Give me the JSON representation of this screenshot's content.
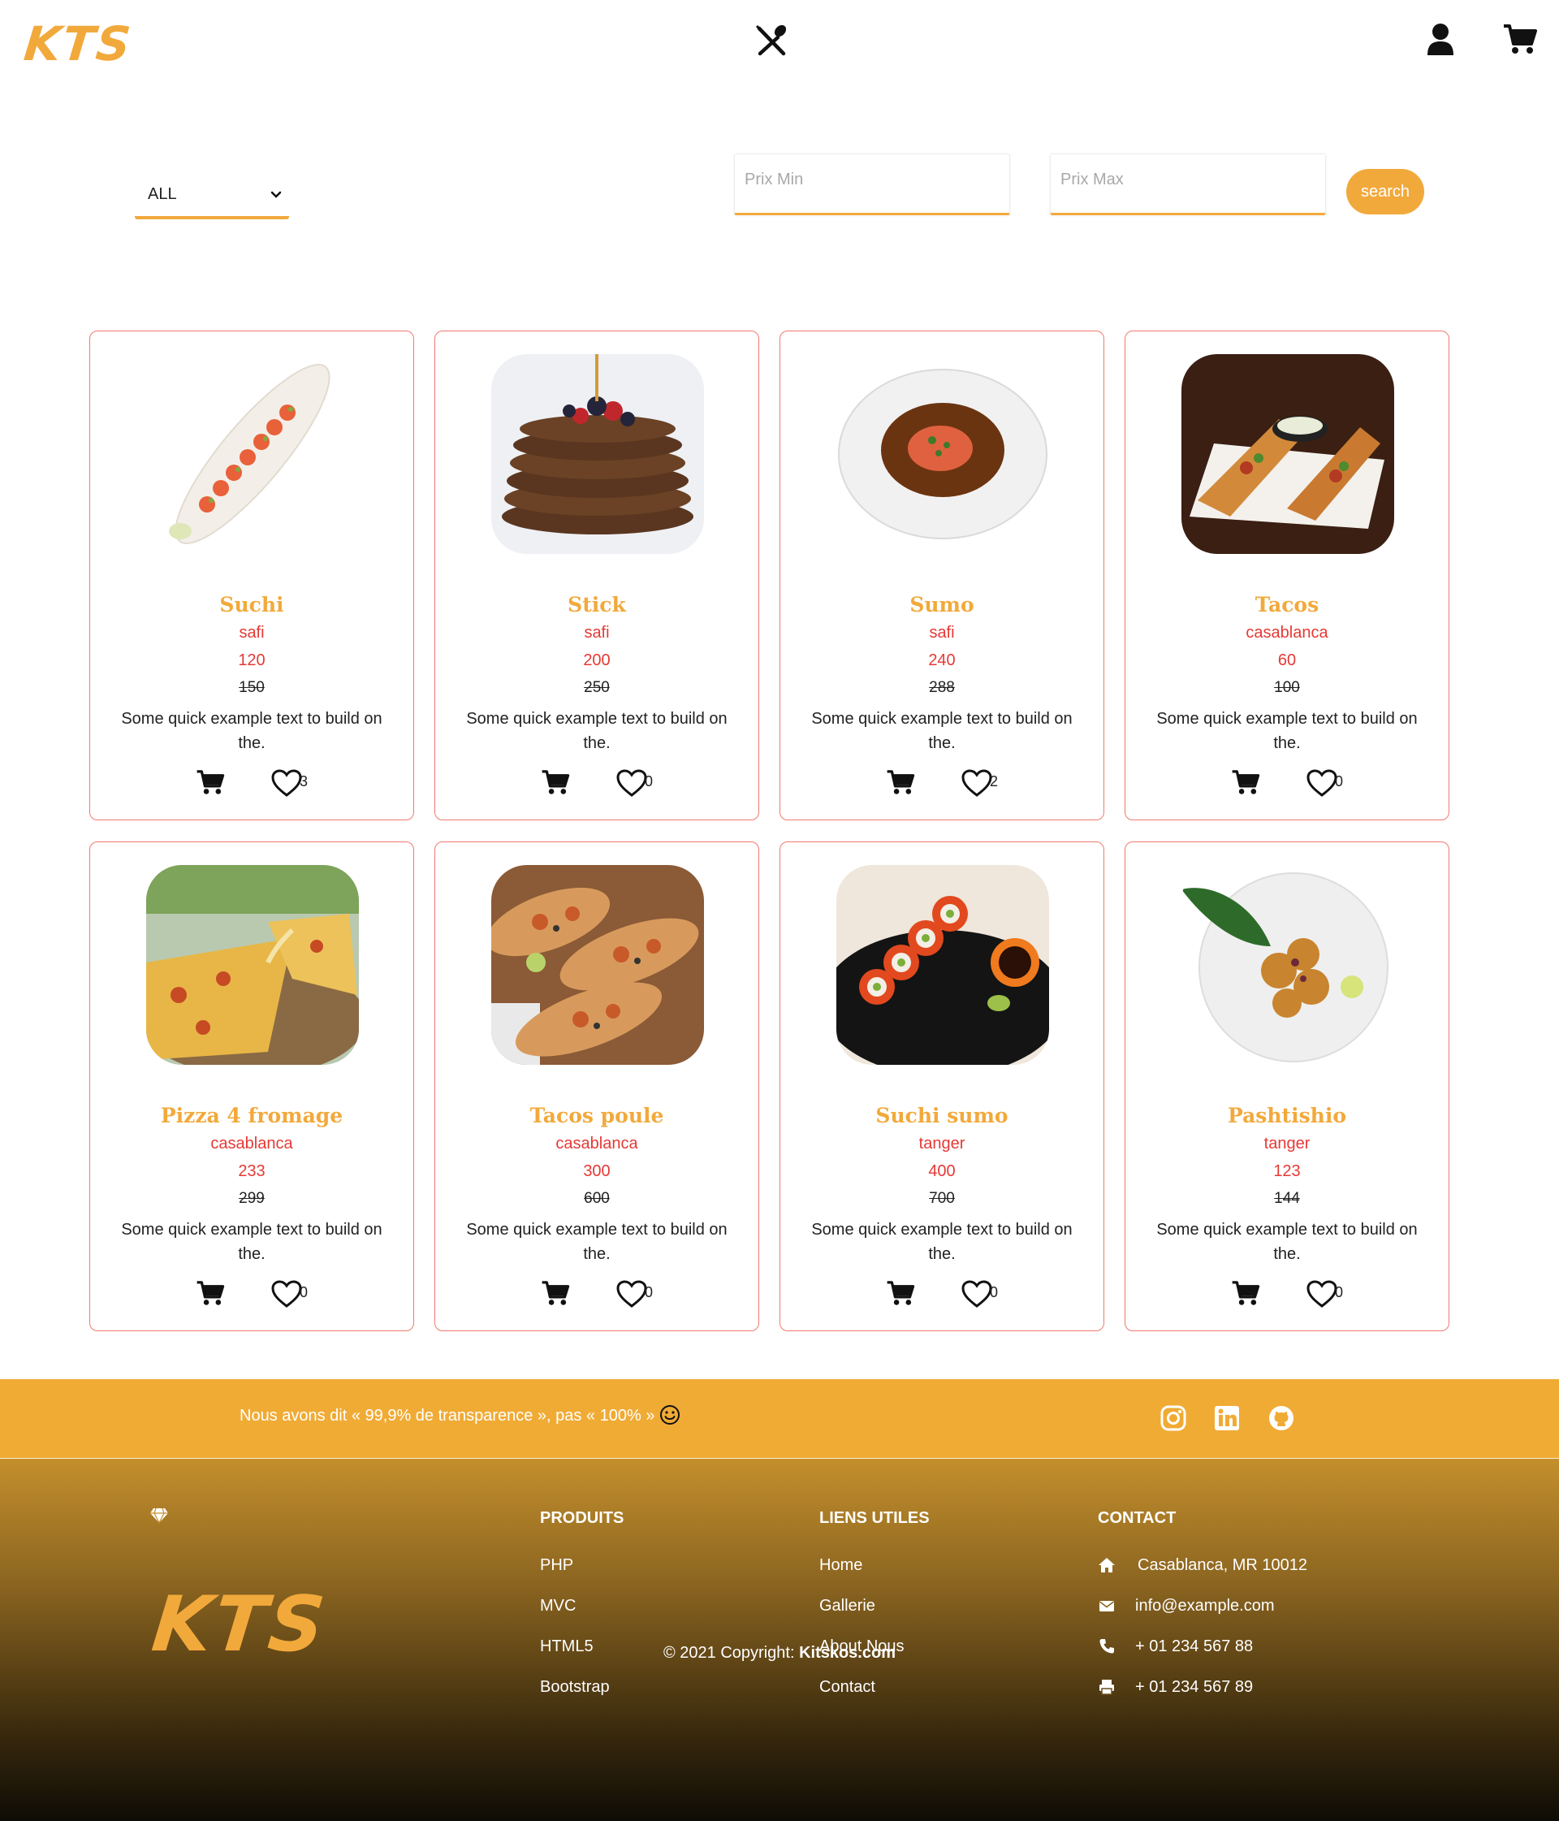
{
  "header": {
    "logo": "KTS"
  },
  "filters": {
    "category_value": "ALL",
    "prix_min_placeholder": "Prix Min",
    "prix_max_placeholder": "Prix Max",
    "search_label": "search"
  },
  "products": [
    {
      "name": "Suchi",
      "city": "safi",
      "price": "120",
      "old_price": "150",
      "desc": "Some quick example text to build on the.",
      "likes": "3"
    },
    {
      "name": "Stick",
      "city": "safi",
      "price": "200",
      "old_price": "250",
      "desc": "Some quick example text to build on the.",
      "likes": "0"
    },
    {
      "name": "Sumo",
      "city": "safi",
      "price": "240",
      "old_price": "288",
      "desc": "Some quick example text to build on the.",
      "likes": "2"
    },
    {
      "name": "Tacos",
      "city": "casablanca",
      "price": "60",
      "old_price": "100",
      "desc": "Some quick example text to build on the.",
      "likes": "0"
    },
    {
      "name": "Pizza 4 fromage",
      "city": "casablanca",
      "price": "233",
      "old_price": "299",
      "desc": "Some quick example text to build on the.",
      "likes": "0"
    },
    {
      "name": "Tacos poule",
      "city": "casablanca",
      "price": "300",
      "old_price": "600",
      "desc": "Some quick example text to build on the.",
      "likes": "0"
    },
    {
      "name": "Suchi sumo",
      "city": "tanger",
      "price": "400",
      "old_price": "700",
      "desc": "Some quick example text to build on the.",
      "likes": "0"
    },
    {
      "name": "Pashtishio",
      "city": "tanger",
      "price": "123",
      "old_price": "144",
      "desc": "Some quick example text to build on the.",
      "likes": "0"
    }
  ],
  "footer": {
    "tagline": "Nous avons dit « 99,9% de transparence », pas « 100% »",
    "logo": "KTS",
    "produits_title": "PRODUITS",
    "produits": [
      "PHP",
      "MVC",
      "HTML5",
      "Bootstrap"
    ],
    "liens_title": "LIENS UTILES",
    "liens": [
      "Home",
      "Gallerie",
      "About Nous",
      "Contact"
    ],
    "contact_title": "CONTACT",
    "address": "Casablanca, MR 10012",
    "email": "info@example.com",
    "phone": "+ 01 234 567 88",
    "fax": "+ 01 234 567 89",
    "copyright_prefix": "© 2021 Copyright:",
    "copyright_site": "Kitskos.com"
  },
  "colors": {
    "accent": "#f2a93b",
    "price_red": "#e53935",
    "card_border": "#f07a6e"
  },
  "icons": [
    "utensils-icon",
    "user-icon",
    "cart-icon",
    "chevron-down-icon",
    "heart-icon",
    "smiley-icon",
    "instagram-icon",
    "linkedin-icon",
    "github-icon",
    "gem-icon",
    "home-icon",
    "envelope-icon",
    "phone-icon",
    "printer-icon"
  ]
}
